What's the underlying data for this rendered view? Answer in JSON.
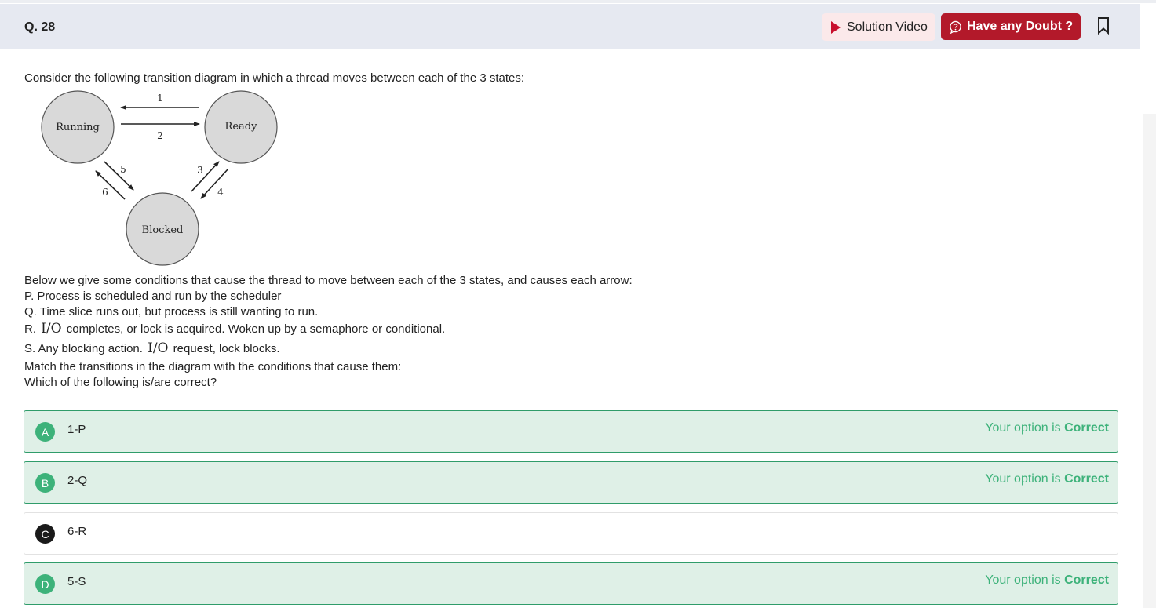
{
  "header": {
    "question_number": "Q. 28",
    "solution_video_label": "Solution Video",
    "doubt_label": "Have any Doubt ?"
  },
  "question": {
    "intro": "Consider the following transition diagram in which a thread moves between each of the 3 states:",
    "diagram": {
      "states": [
        "Running",
        "Ready",
        "Blocked"
      ],
      "arrow_labels": [
        "1",
        "2",
        "3",
        "4",
        "5",
        "6"
      ]
    },
    "line_conditions": "Below we give some conditions that cause the thread to move between each of the 3 states, and causes each arrow:",
    "cond_p": "P. Process is scheduled and run by the scheduler",
    "cond_q": "Q. Time slice runs out, but process is still wanting to run.",
    "cond_r_prefix": "R.",
    "cond_r_io": "I/O",
    "cond_r_suffix": "completes, or lock is acquired. Woken up by a semaphore or conditional.",
    "cond_s_prefix": "S. Any blocking action.",
    "cond_s_io": "I/O",
    "cond_s_suffix": "request, lock blocks.",
    "match_line": "Match the transitions in the diagram with the conditions that cause them:",
    "which_line": "Which of the following is/are correct?"
  },
  "options": [
    {
      "letter": "A",
      "text": "1-P",
      "status_prefix": "Your option is",
      "status_word": "Correct"
    },
    {
      "letter": "B",
      "text": "2-Q",
      "status_prefix": "Your option is",
      "status_word": "Correct"
    },
    {
      "letter": "C",
      "text": "6-R"
    },
    {
      "letter": "D",
      "text": "5-S",
      "status_prefix": "Your option is",
      "status_word": "Correct"
    }
  ],
  "colors": {
    "correct_green": "#3db27a",
    "doubt_red": "#b3192a",
    "header_bg": "#e6e9f1"
  }
}
